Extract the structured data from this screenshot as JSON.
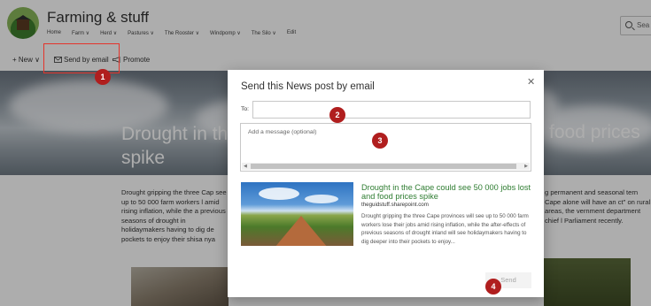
{
  "site": {
    "title": "Farming & stuff",
    "nav": [
      "Home",
      "Farm ∨",
      "Herd ∨",
      "Pastures ∨",
      "The Rooster ∨",
      "Windpomp ∨",
      "The Silo ∨",
      "Edit"
    ],
    "search_placeholder": "Sea"
  },
  "command_bar": {
    "new_label": "+ New ∨",
    "send_by_email_label": "Send by email",
    "promote_label": "Promote"
  },
  "article": {
    "title_left_line1": "Drought in the",
    "title_left_line2": "spike",
    "title_right": "food prices",
    "left_paragraph": "Drought gripping the three Cap see up to 50 000 farm workers l amid rising inflation, while the a previous seasons of drought in holidaymakers having to dig de pockets to enjoy their shisa nya",
    "right_paragraph": "g permanent and seasonal tern Cape alone will have an ct\" on rural areas, the vernment department chief l Parliament recently."
  },
  "dialog": {
    "title": "Send this News post by email",
    "close_glyph": "✕",
    "to_label": "To:",
    "to_value": "",
    "message_placeholder": "Add a message (optional)",
    "preview": {
      "title": "Drought in the Cape could see 50 000 jobs lost and food prices spike",
      "domain": "theguidstuff.sharepoint.com",
      "description": "Drought gripping the three Cape provinces will see up to 50 000 farm workers lose their jobs amid rising inflation, while the after-effects of previous seasons of drought inland will see holidaymakers having to dig deeper into their pockets to enjoy..."
    },
    "send_label": "Send"
  },
  "markers": [
    "1",
    "2",
    "3",
    "4"
  ],
  "colors": {
    "marker": "#b01e1e",
    "highlight": "#e4342b",
    "preview_title": "#2f7d32",
    "overlay": "rgba(0,0,0,0.32)"
  },
  "icons": {
    "search": "search-icon",
    "mail": "mail-icon",
    "promote": "megaphone-icon",
    "close": "close-icon"
  }
}
